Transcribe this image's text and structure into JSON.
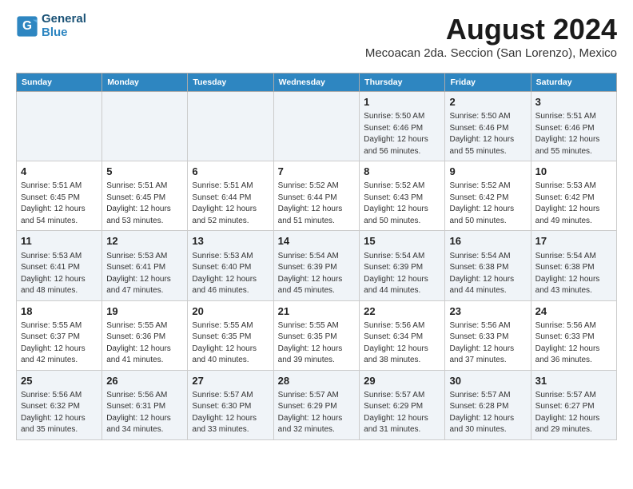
{
  "header": {
    "logo_line1": "General",
    "logo_line2": "Blue",
    "title": "August 2024",
    "subtitle": "Mecoacan 2da. Seccion (San Lorenzo), Mexico"
  },
  "days_of_week": [
    "Sunday",
    "Monday",
    "Tuesday",
    "Wednesday",
    "Thursday",
    "Friday",
    "Saturday"
  ],
  "weeks": [
    [
      {
        "day": "",
        "info": ""
      },
      {
        "day": "",
        "info": ""
      },
      {
        "day": "",
        "info": ""
      },
      {
        "day": "",
        "info": ""
      },
      {
        "day": "1",
        "info": "Sunrise: 5:50 AM\nSunset: 6:46 PM\nDaylight: 12 hours\nand 56 minutes."
      },
      {
        "day": "2",
        "info": "Sunrise: 5:50 AM\nSunset: 6:46 PM\nDaylight: 12 hours\nand 55 minutes."
      },
      {
        "day": "3",
        "info": "Sunrise: 5:51 AM\nSunset: 6:46 PM\nDaylight: 12 hours\nand 55 minutes."
      }
    ],
    [
      {
        "day": "4",
        "info": "Sunrise: 5:51 AM\nSunset: 6:45 PM\nDaylight: 12 hours\nand 54 minutes."
      },
      {
        "day": "5",
        "info": "Sunrise: 5:51 AM\nSunset: 6:45 PM\nDaylight: 12 hours\nand 53 minutes."
      },
      {
        "day": "6",
        "info": "Sunrise: 5:51 AM\nSunset: 6:44 PM\nDaylight: 12 hours\nand 52 minutes."
      },
      {
        "day": "7",
        "info": "Sunrise: 5:52 AM\nSunset: 6:44 PM\nDaylight: 12 hours\nand 51 minutes."
      },
      {
        "day": "8",
        "info": "Sunrise: 5:52 AM\nSunset: 6:43 PM\nDaylight: 12 hours\nand 50 minutes."
      },
      {
        "day": "9",
        "info": "Sunrise: 5:52 AM\nSunset: 6:42 PM\nDaylight: 12 hours\nand 50 minutes."
      },
      {
        "day": "10",
        "info": "Sunrise: 5:53 AM\nSunset: 6:42 PM\nDaylight: 12 hours\nand 49 minutes."
      }
    ],
    [
      {
        "day": "11",
        "info": "Sunrise: 5:53 AM\nSunset: 6:41 PM\nDaylight: 12 hours\nand 48 minutes."
      },
      {
        "day": "12",
        "info": "Sunrise: 5:53 AM\nSunset: 6:41 PM\nDaylight: 12 hours\nand 47 minutes."
      },
      {
        "day": "13",
        "info": "Sunrise: 5:53 AM\nSunset: 6:40 PM\nDaylight: 12 hours\nand 46 minutes."
      },
      {
        "day": "14",
        "info": "Sunrise: 5:54 AM\nSunset: 6:39 PM\nDaylight: 12 hours\nand 45 minutes."
      },
      {
        "day": "15",
        "info": "Sunrise: 5:54 AM\nSunset: 6:39 PM\nDaylight: 12 hours\nand 44 minutes."
      },
      {
        "day": "16",
        "info": "Sunrise: 5:54 AM\nSunset: 6:38 PM\nDaylight: 12 hours\nand 44 minutes."
      },
      {
        "day": "17",
        "info": "Sunrise: 5:54 AM\nSunset: 6:38 PM\nDaylight: 12 hours\nand 43 minutes."
      }
    ],
    [
      {
        "day": "18",
        "info": "Sunrise: 5:55 AM\nSunset: 6:37 PM\nDaylight: 12 hours\nand 42 minutes."
      },
      {
        "day": "19",
        "info": "Sunrise: 5:55 AM\nSunset: 6:36 PM\nDaylight: 12 hours\nand 41 minutes."
      },
      {
        "day": "20",
        "info": "Sunrise: 5:55 AM\nSunset: 6:35 PM\nDaylight: 12 hours\nand 40 minutes."
      },
      {
        "day": "21",
        "info": "Sunrise: 5:55 AM\nSunset: 6:35 PM\nDaylight: 12 hours\nand 39 minutes."
      },
      {
        "day": "22",
        "info": "Sunrise: 5:56 AM\nSunset: 6:34 PM\nDaylight: 12 hours\nand 38 minutes."
      },
      {
        "day": "23",
        "info": "Sunrise: 5:56 AM\nSunset: 6:33 PM\nDaylight: 12 hours\nand 37 minutes."
      },
      {
        "day": "24",
        "info": "Sunrise: 5:56 AM\nSunset: 6:33 PM\nDaylight: 12 hours\nand 36 minutes."
      }
    ],
    [
      {
        "day": "25",
        "info": "Sunrise: 5:56 AM\nSunset: 6:32 PM\nDaylight: 12 hours\nand 35 minutes."
      },
      {
        "day": "26",
        "info": "Sunrise: 5:56 AM\nSunset: 6:31 PM\nDaylight: 12 hours\nand 34 minutes."
      },
      {
        "day": "27",
        "info": "Sunrise: 5:57 AM\nSunset: 6:30 PM\nDaylight: 12 hours\nand 33 minutes."
      },
      {
        "day": "28",
        "info": "Sunrise: 5:57 AM\nSunset: 6:29 PM\nDaylight: 12 hours\nand 32 minutes."
      },
      {
        "day": "29",
        "info": "Sunrise: 5:57 AM\nSunset: 6:29 PM\nDaylight: 12 hours\nand 31 minutes."
      },
      {
        "day": "30",
        "info": "Sunrise: 5:57 AM\nSunset: 6:28 PM\nDaylight: 12 hours\nand 30 minutes."
      },
      {
        "day": "31",
        "info": "Sunrise: 5:57 AM\nSunset: 6:27 PM\nDaylight: 12 hours\nand 29 minutes."
      }
    ]
  ]
}
